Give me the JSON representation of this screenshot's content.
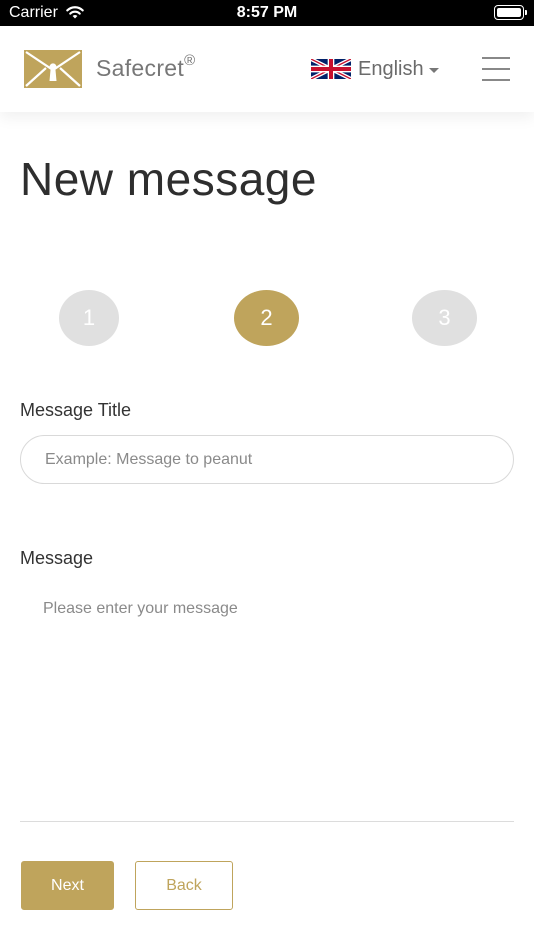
{
  "statusbar": {
    "carrier": "Carrier",
    "time": "8:57 PM"
  },
  "header": {
    "brand": "Safecret",
    "brand_mark": "®",
    "language": "English",
    "icons": {
      "logo": "envelope-logo-icon",
      "flag": "uk-flag-icon",
      "caret": "caret-down-icon",
      "menu": "hamburger-menu-icon"
    }
  },
  "page": {
    "title": "New message"
  },
  "steps": {
    "items": [
      "1",
      "2",
      "3"
    ],
    "active_index": 1
  },
  "form": {
    "title_label": "Message Title",
    "title_placeholder": "Example: Message to peanut",
    "title_value": "",
    "message_label": "Message",
    "message_placeholder": "Please enter your message",
    "message_value": ""
  },
  "buttons": {
    "next": "Next",
    "back": "Back"
  },
  "colors": {
    "accent": "#bfa45c",
    "step_inactive": "#e0e0e0",
    "text": "#2b2b2b",
    "muted": "#8a8a8a"
  }
}
